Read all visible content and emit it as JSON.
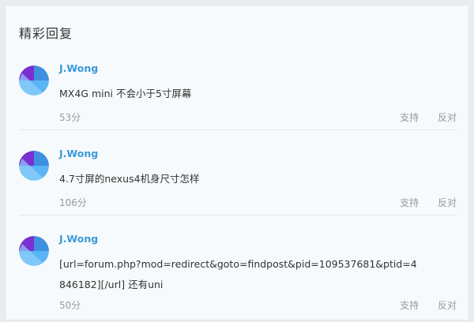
{
  "section": {
    "title": "精彩回复"
  },
  "replies": [
    {
      "author": "J.Wong",
      "content": "MX4G mini 不会小于5寸屏幕",
      "score": "53分"
    },
    {
      "author": "J.Wong",
      "content": "4.7寸屏的nexus4机身尺寸怎样",
      "score": "106分"
    },
    {
      "author": "J.Wong",
      "content": "[url=forum.php?mod=redirect&goto=findpost&pid=109537681&ptid=4846182][/url] 还有uni",
      "score": "50分"
    }
  ],
  "actions": {
    "support_label": "支持",
    "oppose_label": "反对"
  },
  "colors": {
    "author": "#3a9ad9",
    "avatar_top": "#7b2fd1",
    "avatar_bottom": "#4aa9f0"
  },
  "icons": {
    "avatar": "meizu-avatar-icon"
  }
}
